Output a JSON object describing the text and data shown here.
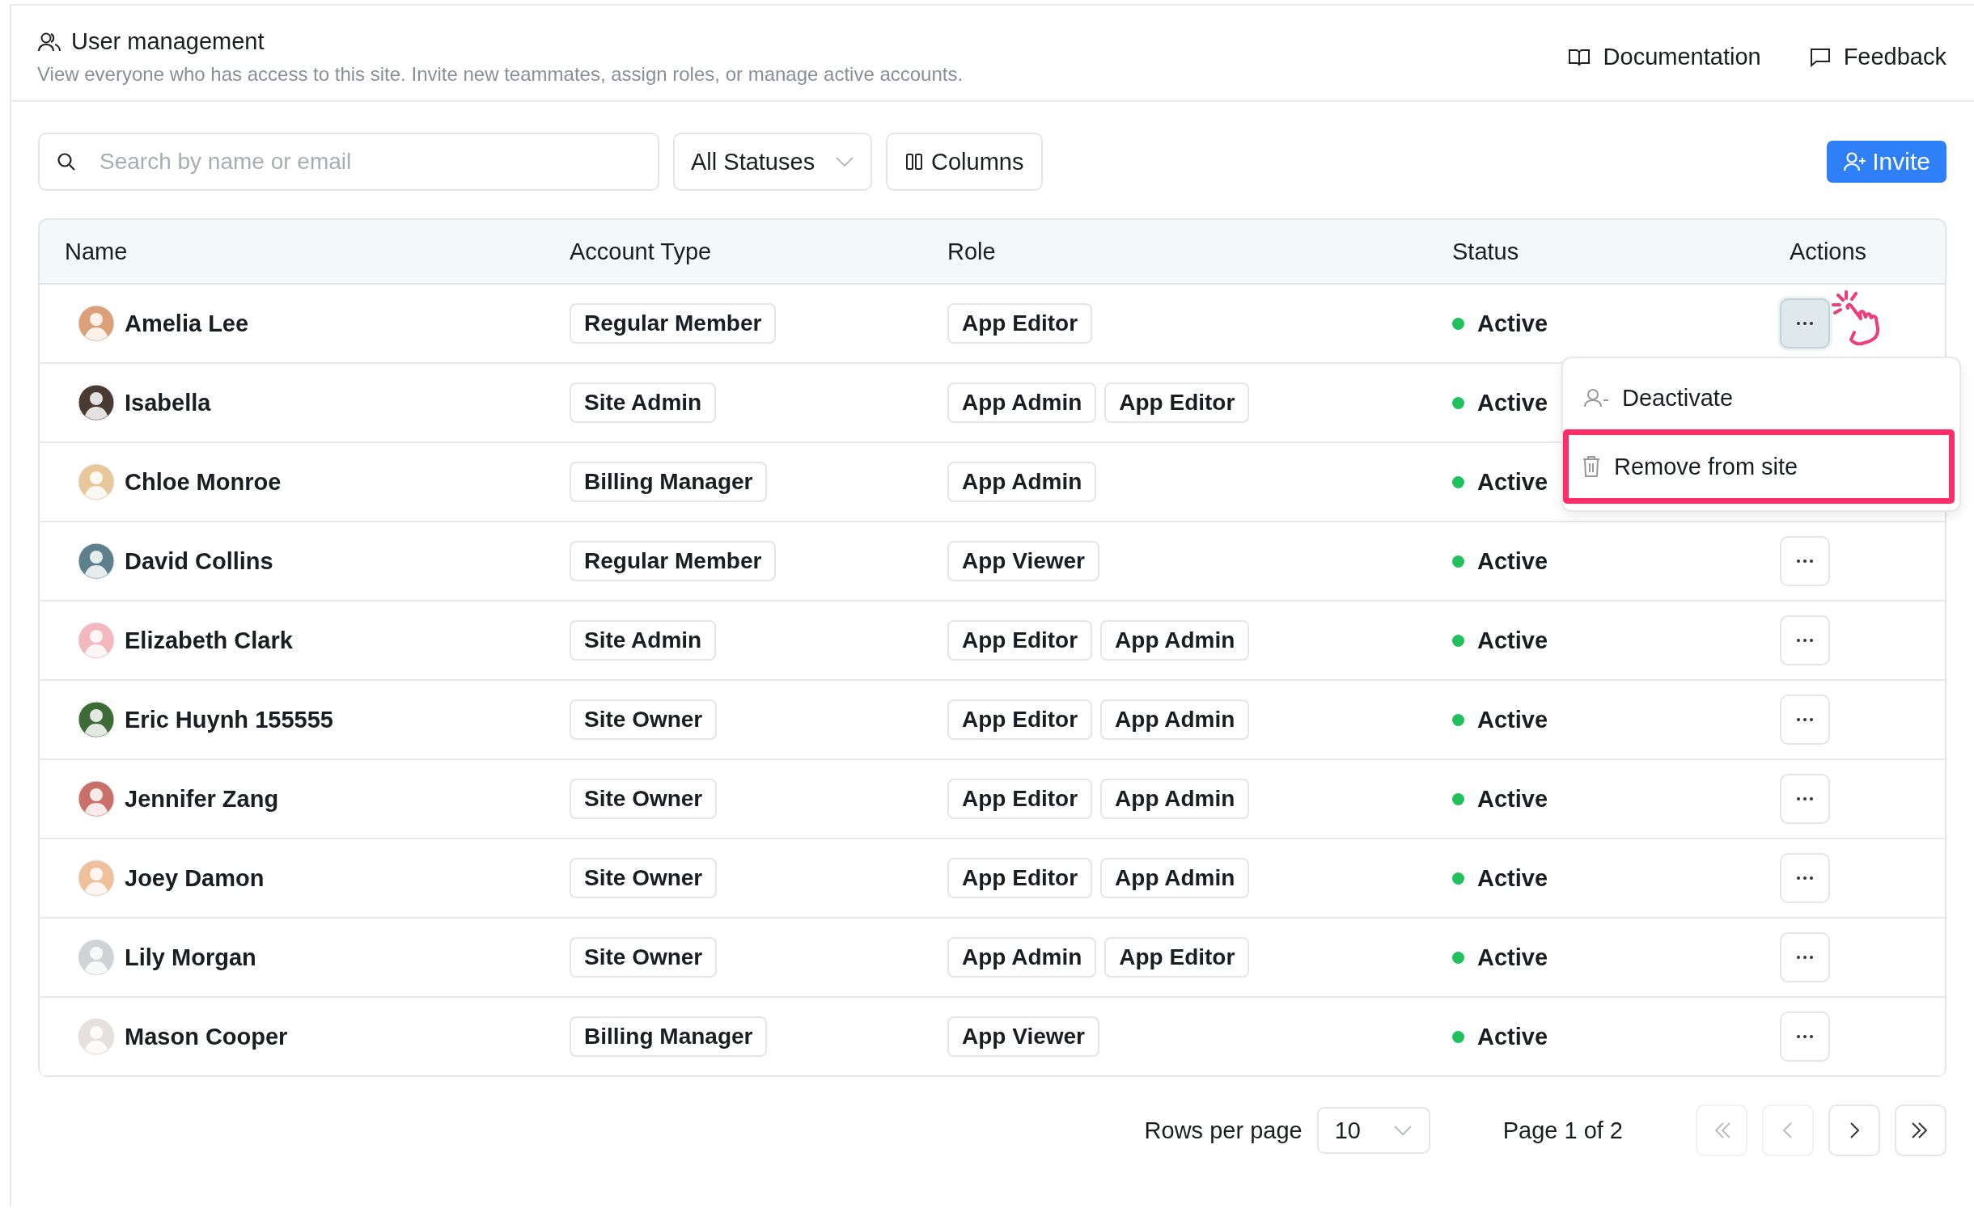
{
  "header": {
    "title": "User management",
    "subtitle": "View everyone who has access to this site. Invite new teammates, assign roles, or manage active accounts.",
    "links": [
      {
        "kind": "docs",
        "label": "Documentation"
      },
      {
        "kind": "feedback",
        "label": "Feedback"
      }
    ]
  },
  "toolbar": {
    "search": {
      "placeholder": "Search by name or email"
    },
    "status_filter": "All Statuses",
    "columns_button": "Columns",
    "invite_button": "Invite"
  },
  "table": {
    "columns": [
      "Name",
      "Account Type",
      "Role",
      "Status",
      "Actions"
    ],
    "rows": [
      {
        "name": "Amelia Lee",
        "account_type": "Regular Member",
        "roles": [
          "App Editor"
        ],
        "status": "Active",
        "menu_open": true,
        "actions_covered": false
      },
      {
        "name": "Isabella",
        "account_type": "Site Admin",
        "roles": [
          "App Admin",
          "App Editor"
        ],
        "status": "Active",
        "menu_open": false,
        "actions_covered": true
      },
      {
        "name": "Chloe Monroe",
        "account_type": "Billing Manager",
        "roles": [
          "App Admin"
        ],
        "status": "Active",
        "menu_open": false,
        "actions_covered": true
      },
      {
        "name": "David Collins",
        "account_type": "Regular Member",
        "roles": [
          "App Viewer"
        ],
        "status": "Active",
        "menu_open": false,
        "actions_covered": false
      },
      {
        "name": "Elizabeth Clark",
        "account_type": "Site Admin",
        "roles": [
          "App Editor",
          "App Admin"
        ],
        "status": "Active",
        "menu_open": false,
        "actions_covered": false
      },
      {
        "name": "Eric Huynh 155555",
        "account_type": "Site Owner",
        "roles": [
          "App Editor",
          "App Admin"
        ],
        "status": "Active",
        "menu_open": false,
        "actions_covered": false
      },
      {
        "name": "Jennifer Zang",
        "account_type": "Site Owner",
        "roles": [
          "App Editor",
          "App Admin"
        ],
        "status": "Active",
        "menu_open": false,
        "actions_covered": false
      },
      {
        "name": "Joey Damon",
        "account_type": "Site Owner",
        "roles": [
          "App Editor",
          "App Admin"
        ],
        "status": "Active",
        "menu_open": false,
        "actions_covered": false
      },
      {
        "name": "Lily Morgan",
        "account_type": "Site Owner",
        "roles": [
          "App Admin",
          "App Editor"
        ],
        "status": "Active",
        "menu_open": false,
        "actions_covered": false
      },
      {
        "name": "Mason Cooper",
        "account_type": "Billing Manager",
        "roles": [
          "App Viewer"
        ],
        "status": "Active",
        "menu_open": false,
        "actions_covered": false
      }
    ],
    "actions_menu": [
      {
        "kind": "deactivate",
        "label": "Deactivate",
        "highlighted": false
      },
      {
        "kind": "remove",
        "label": "Remove from site",
        "highlighted": true
      }
    ]
  },
  "pagination": {
    "rows_per_page_label": "Rows per page",
    "rows_per_page": "10",
    "page_info": "Page 1 of 2",
    "buttons": [
      {
        "kind": "first",
        "disabled": true
      },
      {
        "kind": "previous",
        "disabled": true
      },
      {
        "kind": "next",
        "disabled": false
      },
      {
        "kind": "last",
        "disabled": false
      }
    ]
  }
}
